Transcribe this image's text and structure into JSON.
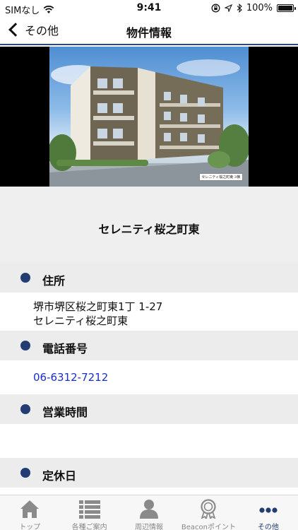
{
  "status_bar": {
    "carrier": "SIMなし",
    "time": "9:41",
    "battery": "100%",
    "battery_level": 1.0
  },
  "nav": {
    "back_label": "その他",
    "title": "物件情報"
  },
  "hero": {
    "caption": "セレニティ桜之町東 3棟"
  },
  "property": {
    "name": "セレニティ桜之町東"
  },
  "sections": {
    "address": {
      "label": "住所",
      "line1": "堺市堺区桜之町東1丁 1-27",
      "line2": "セレニティ桜之町東"
    },
    "phone": {
      "label": "電話番号",
      "value": "06-6312-7212"
    },
    "hours": {
      "label": "営業時間"
    },
    "holiday": {
      "label": "定休日"
    }
  },
  "tab_bar": {
    "active": "other",
    "items": [
      {
        "id": "top",
        "label": "トップ",
        "icon": "home-icon"
      },
      {
        "id": "guide",
        "label": "各種ご案内",
        "icon": "list-icon"
      },
      {
        "id": "nearby",
        "label": "周辺情報",
        "icon": "person-icon"
      },
      {
        "id": "beacon",
        "label": "Beaconポイント",
        "icon": "award-badge-icon"
      },
      {
        "id": "other",
        "label": "その他",
        "icon": "more-dots-icon"
      }
    ]
  },
  "colors": {
    "accent": "#233d72",
    "link": "#1a2fc7",
    "section_bg": "#ececec"
  }
}
